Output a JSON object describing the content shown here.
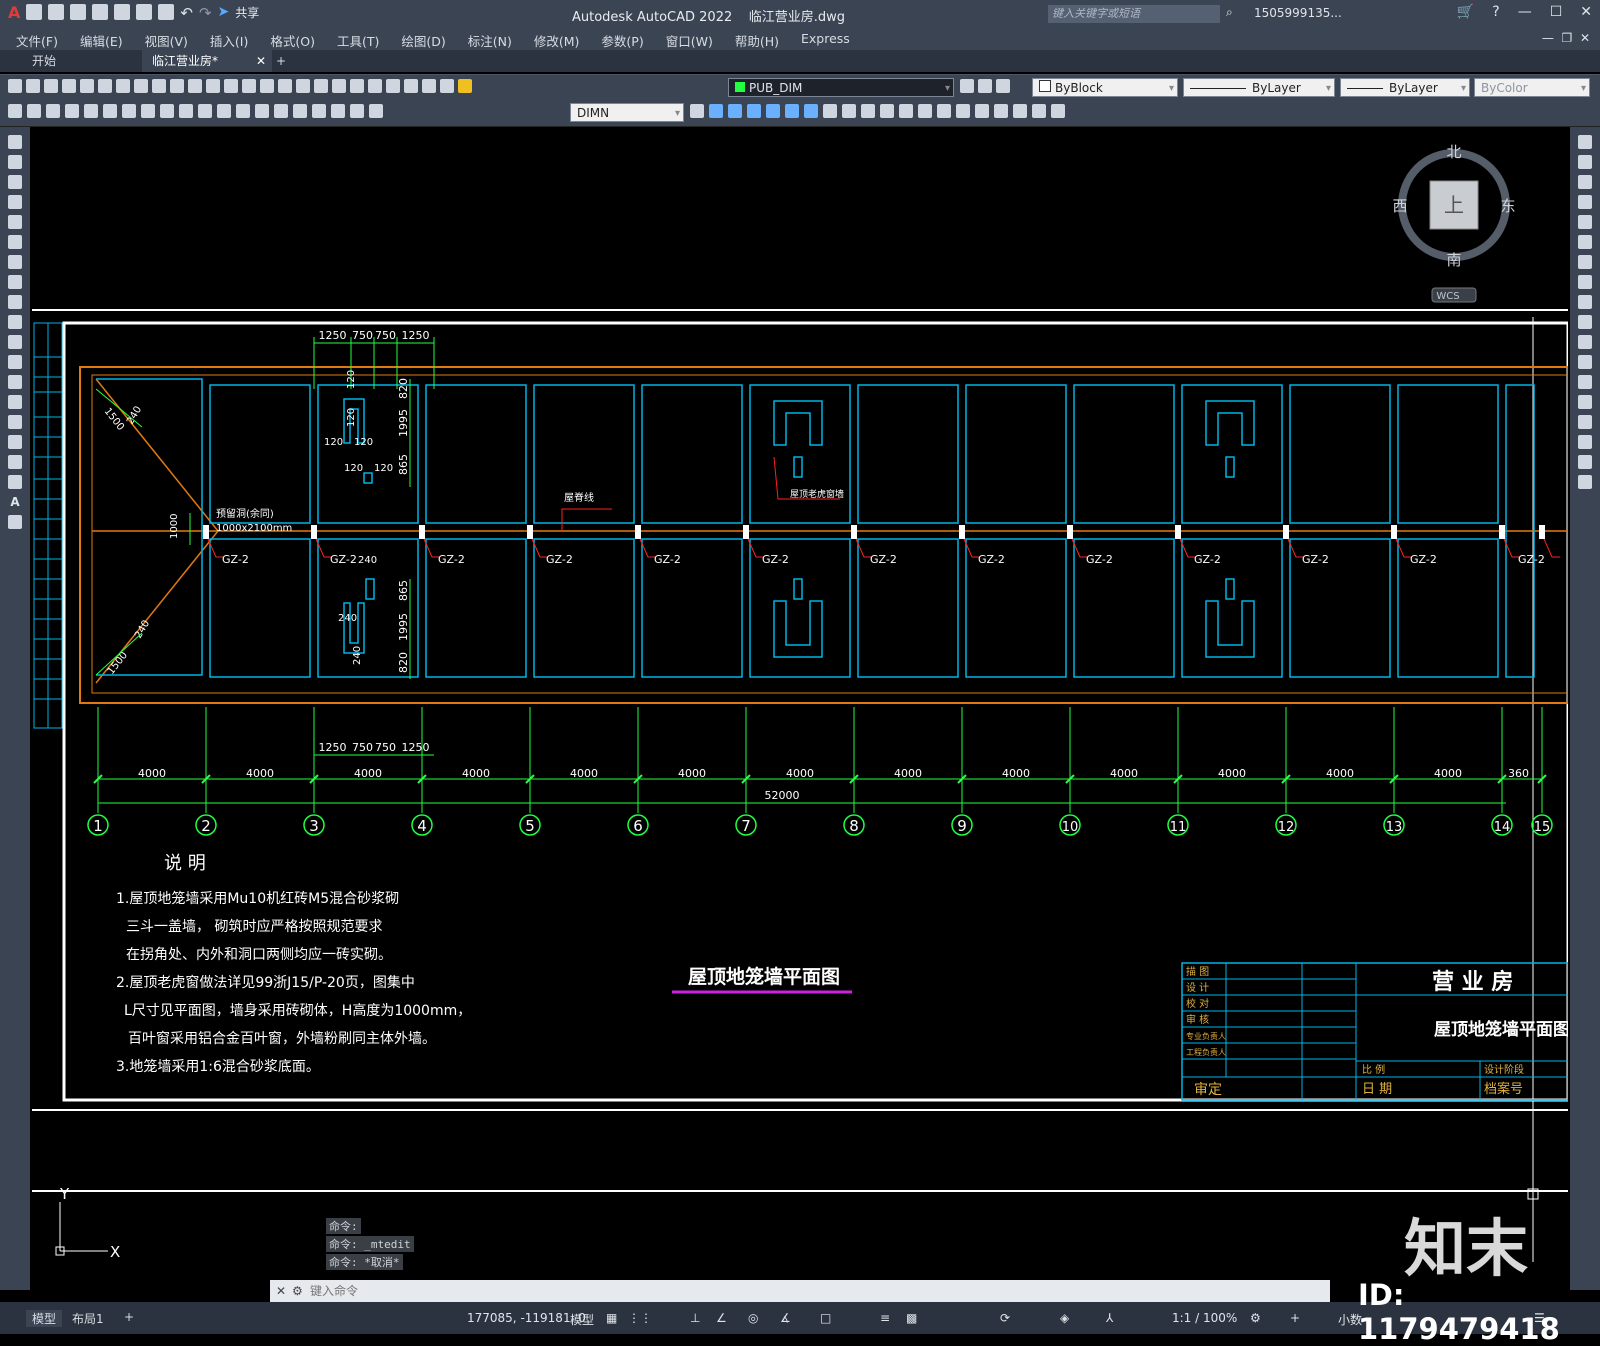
{
  "app": {
    "title": "Autodesk AutoCAD 2022",
    "filename": "临江营业房.dwg",
    "share": "共享",
    "search_placeholder": "键入关键字或短语",
    "user": "1505999135..."
  },
  "menu": [
    "文件(F)",
    "编辑(E)",
    "视图(V)",
    "插入(I)",
    "格式(O)",
    "工具(T)",
    "绘图(D)",
    "标注(N)",
    "修改(M)",
    "参数(P)",
    "窗口(W)",
    "帮助(H)",
    "Express"
  ],
  "tabs": [
    "开始",
    "临江营业房*"
  ],
  "toolbar": {
    "layer": "PUB_DIM",
    "color": "ByBlock",
    "linetype": "ByLayer",
    "lineweight": "ByLayer",
    "plotstyle": "ByColor",
    "dimstyle": "DIMN"
  },
  "viewcube": {
    "north": "北",
    "south": "南",
    "east": "东",
    "west": "西",
    "top": "上",
    "wcs": "WCS"
  },
  "drawing": {
    "bay_dims": [
      "4000",
      "4000",
      "4000",
      "4000",
      "4000",
      "4000",
      "4000",
      "4000",
      "4000",
      "4000",
      "4000",
      "4000",
      "4000",
      "360"
    ],
    "total_dim": "52000",
    "axes": [
      "1",
      "2",
      "3",
      "4",
      "5",
      "6",
      "7",
      "8",
      "9",
      "10",
      "11",
      "12",
      "13",
      "14",
      "15"
    ],
    "column_label": "GZ-2",
    "detail_top": [
      "1250",
      "750",
      "750",
      "1250"
    ],
    "detail_bottom": [
      "1250",
      "750",
      "750",
      "1250"
    ],
    "vert_dims_upper": [
      "820",
      "1995",
      "865"
    ],
    "vert_dims_lower": [
      "865",
      "1995",
      "820"
    ],
    "small_dims": [
      "120",
      "120",
      "120",
      "120",
      "120",
      "120",
      "240",
      "240",
      "240"
    ],
    "diag_dims": [
      "1500",
      "240",
      "240",
      "1500"
    ],
    "opening_note": [
      "预留洞(余同)",
      "1000x2100mm"
    ],
    "opening_dim": "1000",
    "ridge_note": "屋脊线",
    "window_note": "屋顶老虎窗墙",
    "notes_title": "说    明",
    "notes": [
      "1.屋顶地笼墙采用Mu10机红砖M5混合砂浆砌",
      "三斗一盖墙， 砌筑时应严格按照规范要求",
      "在拐角处、内外和洞口两侧均应一砖实砌。",
      "2.屋顶老虎窗做法详见99浙J15/P-20页，图集中",
      "L尺寸见平面图，墙身采用砖砌体，H高度为1000mm，",
      "百叶窗采用铝合金百叶窗，外墙粉刷同主体外墙。",
      "3.地笼墙采用1:6混合砂浆底面。"
    ],
    "plan_title": "屋顶地笼墙平面图",
    "titleblock": {
      "rows": [
        "描  图",
        "设  计",
        "校  对",
        "审  核",
        "专业负责人",
        "工程负责人"
      ],
      "approve": "审定",
      "project": "营 业 房",
      "drawing_name": "屋顶地笼墙平面图",
      "scale": "比  例",
      "date": "日  期",
      "stage": "设计阶段",
      "archive": "档案号"
    },
    "ucs": {
      "x": "X",
      "y": "Y"
    }
  },
  "command_history": [
    "命令:",
    "命令: _mtedit",
    "命令: *取消*"
  ],
  "command_placeholder": "键入命令",
  "status": {
    "tabs": [
      "模型",
      "布局1"
    ],
    "coords": "177085, -119181, 0",
    "model": "模型",
    "scale": "1:1 / 100%",
    "units": "小数"
  },
  "watermark": {
    "brand": "知末",
    "id": "ID: 1179479418"
  },
  "colors": {
    "cyan": "#00b4e6",
    "orange": "#e07a10",
    "green": "#20ff40",
    "red": "#ff2020",
    "white": "#ffffff"
  }
}
